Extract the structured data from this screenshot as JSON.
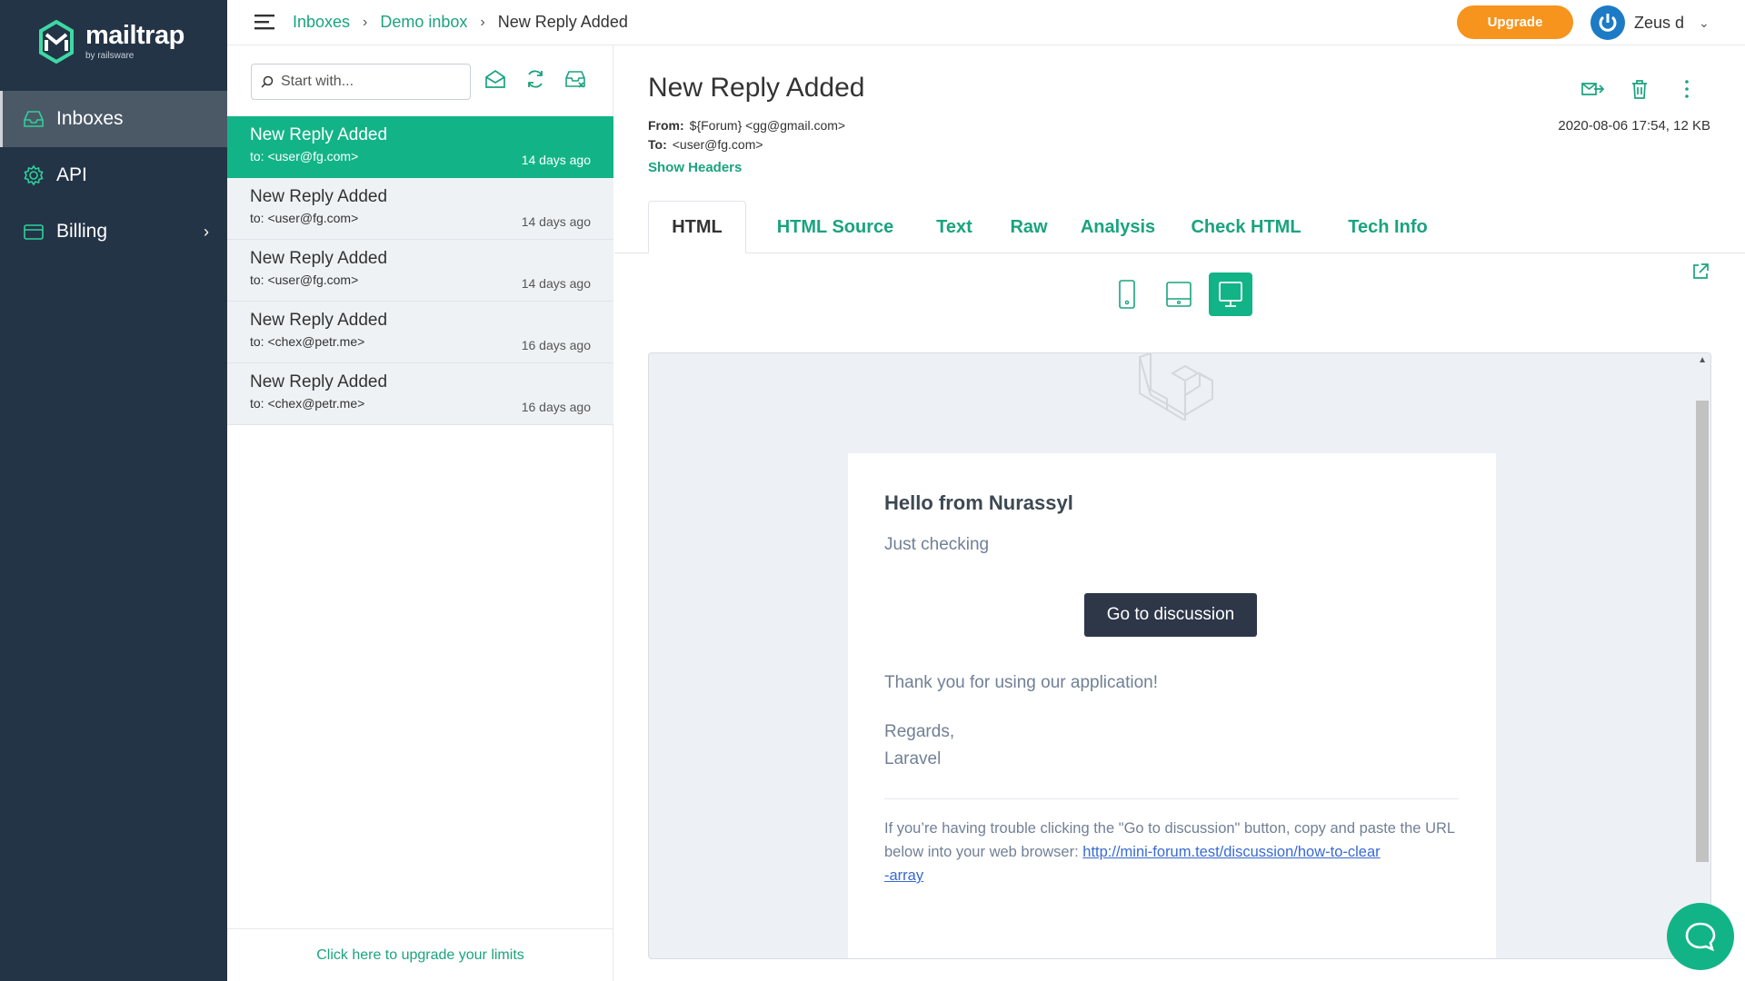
{
  "brand": {
    "name": "mailtrap",
    "sub": "by railsware"
  },
  "nav": {
    "items": [
      {
        "label": "Inboxes",
        "icon": "inbox-icon"
      },
      {
        "label": "API",
        "icon": "gear-icon"
      },
      {
        "label": "Billing",
        "icon": "card-icon"
      }
    ]
  },
  "breadcrumb": {
    "inboxes": "Inboxes",
    "sep1": "›",
    "demo": "Demo inbox",
    "sep2": "›",
    "current": "New Reply Added"
  },
  "header": {
    "upgrade_label": "Upgrade",
    "user_name": "Zeus d",
    "user_chevron": "⌄"
  },
  "list": {
    "search_placeholder": "Start with...",
    "items": [
      {
        "subject": "New Reply Added",
        "to": "to: <user@fg.com>",
        "time": "14 days ago"
      },
      {
        "subject": "New Reply Added",
        "to": "to: <user@fg.com>",
        "time": "14 days ago"
      },
      {
        "subject": "New Reply Added",
        "to": "to: <user@fg.com>",
        "time": "14 days ago"
      },
      {
        "subject": "New Reply Added",
        "to": "to: <chex@petr.me>",
        "time": "16 days ago"
      },
      {
        "subject": "New Reply Added",
        "to": "to: <chex@petr.me>",
        "time": "16 days ago"
      }
    ],
    "footer_link": "Click here to upgrade your limits"
  },
  "message": {
    "subject": "New Reply Added",
    "from_label": "From:",
    "from_value": "${Forum} <gg@gmail.com>",
    "to_label": "To:",
    "to_value": "<user@fg.com>",
    "show_headers": "Show Headers",
    "date_size": "2020-08-06 17:54, 12 KB"
  },
  "tabs": [
    "HTML",
    "HTML Source",
    "Text",
    "Raw",
    "Analysis",
    "Check HTML",
    "Tech Info"
  ],
  "email": {
    "hello": "Hello from Nurassyl",
    "line1": "Just checking",
    "button": "Go to discussion",
    "thanks": "Thank you for using our application!",
    "regards": "Regards,",
    "sign": "Laravel",
    "trouble": "If you’re having trouble clicking the \"Go to discussion\" button, copy and paste the URL below into your web browser:",
    "url_part1": "http://mini-forum.test/discussion/how-to-clear",
    "url_part2": "-array"
  },
  "colors": {
    "accent": "#12b487",
    "sidebar": "#243447",
    "upgrade": "#f7941d"
  }
}
